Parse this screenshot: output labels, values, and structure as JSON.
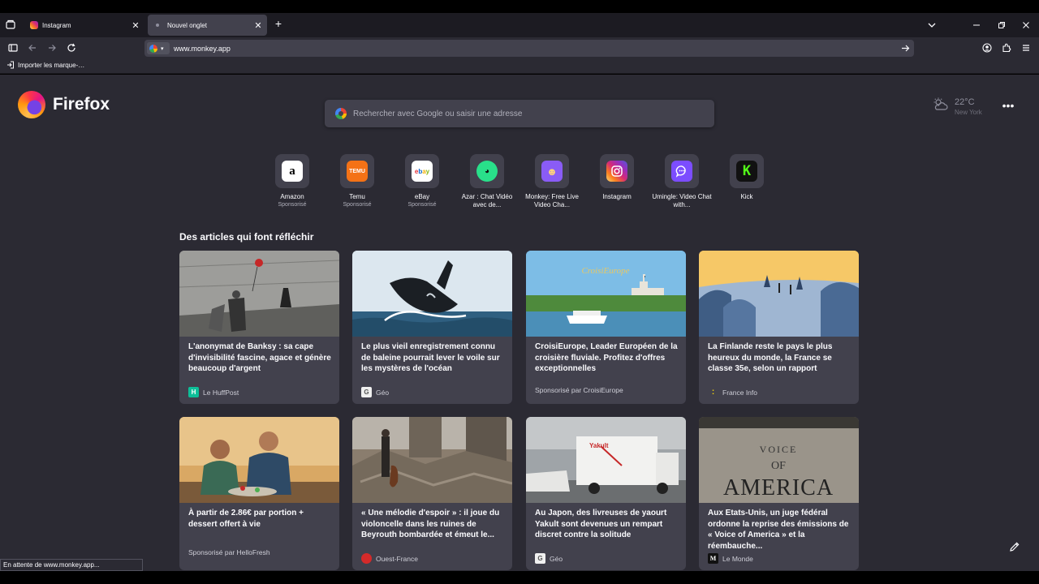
{
  "tabs": [
    {
      "title": "Instagram",
      "active": false
    },
    {
      "title": "Nouvel onglet",
      "active": true
    }
  ],
  "urlbar": {
    "value": "www.monkey.app"
  },
  "bookmarks": [
    {
      "label": "Importer les marque-…"
    }
  ],
  "newtab": {
    "brand": "Firefox",
    "search_placeholder": "Rechercher avec Google ou saisir une adresse",
    "weather": {
      "temp": "22°C",
      "city": "New York"
    }
  },
  "shortcuts": [
    {
      "name": "Amazon",
      "sponsor": "Sponsorisé",
      "icon": "amazon-icon",
      "color": "#ffffff"
    },
    {
      "name": "Temu",
      "sponsor": "Sponsorisé",
      "icon": "temu-icon",
      "color": "#f47216"
    },
    {
      "name": "eBay",
      "sponsor": "Sponsorisé",
      "icon": "ebay-icon",
      "color": "#ffffff"
    },
    {
      "name": "Azar : Chat Vidéo avec de...",
      "sponsor": "",
      "icon": "azar-icon",
      "color": "#29e08a"
    },
    {
      "name": "Monkey: Free Live Video Cha...",
      "sponsor": "",
      "icon": "monkey-icon",
      "color": "#8a5cf6"
    },
    {
      "name": "Instagram",
      "sponsor": "",
      "icon": "instagram-icon",
      "color": "#e1306c"
    },
    {
      "name": "Umingle: Video Chat with...",
      "sponsor": "",
      "icon": "umingle-icon",
      "color": "#7c4dff"
    },
    {
      "name": "Kick",
      "sponsor": "",
      "icon": "kick-icon",
      "color": "#53fc18"
    }
  ],
  "section_title": "Des articles qui font réfléchir",
  "articles": [
    {
      "headline": "L'anonymat de Banksy : sa cape d'invisibilité fascine, agace et génère beaucoup d'argent",
      "source": "Le HuffPost",
      "source_icon": "huffpost-icon",
      "sponsored": false
    },
    {
      "headline": "Le plus vieil enregistrement connu de baleine pourrait lever le voile sur les mystères de l'océan",
      "source": "Géo",
      "source_icon": "geo-icon",
      "sponsored": false
    },
    {
      "headline": "CroisiEurope, Leader Européen de la croisière fluviale. Profitez d'offres exceptionnelles",
      "source": "Sponsorisé par CroisiEurope",
      "source_icon": "",
      "sponsored": true
    },
    {
      "headline": "La Finlande reste le pays le plus heureux du monde, la France se classe 35e, selon un rapport",
      "source": "France Info",
      "source_icon": "franceinfo-icon",
      "sponsored": false
    },
    {
      "headline": "À partir de 2.86€ par portion + dessert offert à vie",
      "source": "Sponsorisé par HelloFresh",
      "source_icon": "",
      "sponsored": true
    },
    {
      "headline": "« Une mélodie d'espoir » : il joue du violoncelle dans les ruines de Beyrouth bombardée et émeut le...",
      "source": "Ouest-France",
      "source_icon": "ouestfrance-icon",
      "sponsored": false
    },
    {
      "headline": "Au Japon, des livreuses de yaourt Yakult sont devenues un rempart discret contre la solitude",
      "source": "Géo",
      "source_icon": "geo-icon",
      "sponsored": false
    },
    {
      "headline": "Aux Etats-Unis, un juge fédéral ordonne la reprise des émissions de « Voice of America » et la réembauche...",
      "source": "Le Monde",
      "source_icon": "lemonde-icon",
      "sponsored": false
    }
  ],
  "status": "En attente de www.monkey.app..."
}
